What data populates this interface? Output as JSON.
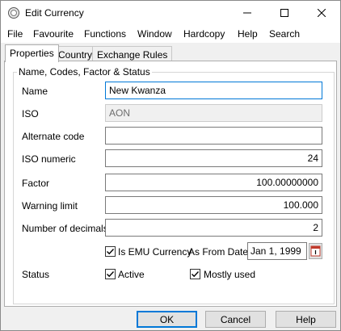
{
  "window": {
    "title": "Edit Currency",
    "icon": "currency-app-icon"
  },
  "menu": [
    "File",
    "Favourite",
    "Functions",
    "Window",
    "Hardcopy",
    "Help",
    "Search"
  ],
  "tabs": [
    "Properties",
    "Country",
    "Exchange Rules"
  ],
  "group": {
    "title": "Name, Codes, Factor & Status"
  },
  "fields": {
    "name": {
      "label": "Name",
      "value": "New Kwanza"
    },
    "iso": {
      "label": "ISO",
      "value": "AON"
    },
    "alternate_code": {
      "label": "Alternate code",
      "value": ""
    },
    "iso_numeric": {
      "label": "ISO numeric",
      "value": "24"
    },
    "factor": {
      "label": "Factor",
      "value": "100.00000000"
    },
    "warning_limit": {
      "label": "Warning limit",
      "value": "100.000"
    },
    "decimals": {
      "label": "Number of decimals",
      "value": "2"
    }
  },
  "emu": {
    "label": "Is EMU Currency",
    "checked": true,
    "as_from_label": "As From Date",
    "date": "Jan 1, 1999"
  },
  "status": {
    "label": "Status",
    "active_label": "Active",
    "active_checked": true,
    "mostly_used_label": "Mostly used",
    "mostly_used_checked": true
  },
  "buttons": {
    "ok": "OK",
    "cancel": "Cancel",
    "help": "Help"
  },
  "colors": {
    "accent": "#0078d7",
    "calendar_icon": "#c0392b"
  }
}
